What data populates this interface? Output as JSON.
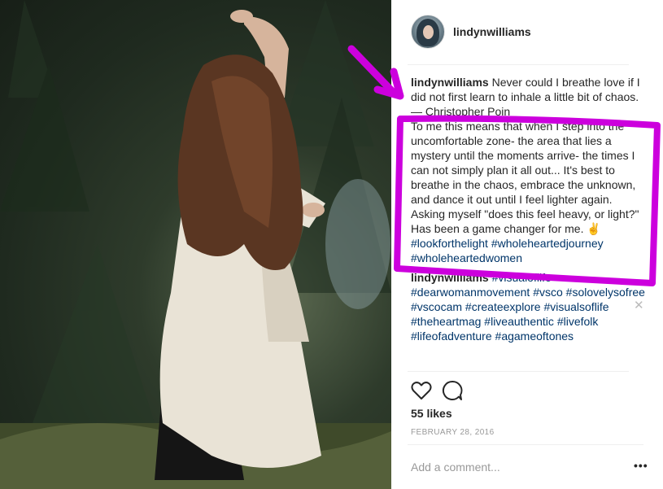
{
  "post": {
    "username": "lindynwilliams",
    "caption": {
      "username": "lindynwilliams",
      "line1": "Never could I breathe love if I did not first learn to inhale a little bit of chaos. — Christopher Poin",
      "body": "To me this means that when I step into the uncomfortable zone- the area that lies a mystery until the moments arrive- the times I can not simply plan it all out... It's best to breathe in the chaos, embrace the unknown, and dance it out until I feel lighter again. Asking myself \"does this feel heavy, or light?\" Has been a game changer for me. ✌️",
      "tags": [
        "#lookforthelight",
        "#wholeheartedjourney",
        "#wholeheartedwomen"
      ]
    },
    "comment2": {
      "username": "lindynwilliams",
      "tags": [
        "#visualoflife",
        "#dearwomanmovement",
        "#vsco",
        "#solovelysofree",
        "#vscocam",
        "#createexplore",
        "#visualsoflife",
        "#theheartmag",
        "#liveauthentic",
        "#livefolk",
        "#lifeofadventure",
        "#agameoftones"
      ]
    },
    "likes": "55 likes",
    "date": "FEBRUARY 28, 2016",
    "add_comment_placeholder": "Add a comment...",
    "more_label": "•••",
    "close_label": "✕",
    "icons": [
      "heart-icon",
      "comment-icon"
    ]
  },
  "colors": {
    "annotation": "#cc00dd",
    "hashtag": "#003569",
    "text": "#262626",
    "muted": "#999999"
  }
}
